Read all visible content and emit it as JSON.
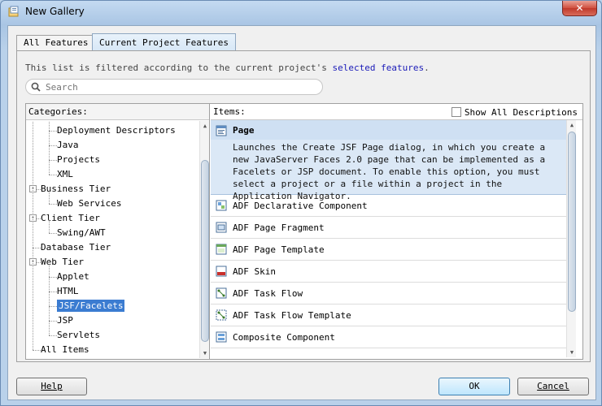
{
  "window": {
    "title": "New Gallery",
    "close_label": "✕"
  },
  "tabs": [
    {
      "label": "All Features",
      "active": false
    },
    {
      "label": "Current Project Features",
      "active": true
    }
  ],
  "filter": {
    "text": "This list is filtered according to the current project's ",
    "link": "selected features",
    "suffix": "."
  },
  "search": {
    "placeholder": "Search"
  },
  "categories": {
    "header": "Categories:",
    "items": [
      {
        "label": "Deployment Descriptors",
        "level": 2
      },
      {
        "label": "Java",
        "level": 2
      },
      {
        "label": "Projects",
        "level": 2
      },
      {
        "label": "XML",
        "level": 2
      },
      {
        "label": "Business Tier",
        "level": 1,
        "expander": "-"
      },
      {
        "label": "Web Services",
        "level": 2
      },
      {
        "label": "Client Tier",
        "level": 1,
        "expander": "-"
      },
      {
        "label": "Swing/AWT",
        "level": 2
      },
      {
        "label": "Database Tier",
        "level": 1
      },
      {
        "label": "Web Tier",
        "level": 1,
        "expander": "-"
      },
      {
        "label": "Applet",
        "level": 2
      },
      {
        "label": "HTML",
        "level": 2
      },
      {
        "label": "JSF/Facelets",
        "level": 2,
        "selected": true
      },
      {
        "label": "JSP",
        "level": 2
      },
      {
        "label": "Servlets",
        "level": 2
      },
      {
        "label": "All Items",
        "level": 1
      }
    ]
  },
  "items_pane": {
    "header": "Items:",
    "show_all_label": "Show All Descriptions",
    "show_all_checked": false,
    "selected": {
      "name": "Page",
      "description": "Launches the Create JSF Page dialog, in which you create a new JavaServer Faces 2.0 page that can be implemented as a Facelets or JSP document. To enable this option, you must select a project or a file within a project in the Application Navigator."
    },
    "items": [
      {
        "name": "ADF Declarative Component",
        "icon": "component-icon"
      },
      {
        "name": "ADF Page Fragment",
        "icon": "page-fragment-icon"
      },
      {
        "name": "ADF Page Template",
        "icon": "page-template-icon"
      },
      {
        "name": "ADF Skin",
        "icon": "css-skin-icon"
      },
      {
        "name": "ADF Task Flow",
        "icon": "task-flow-icon"
      },
      {
        "name": "ADF Task Flow Template",
        "icon": "task-flow-template-icon"
      },
      {
        "name": "Composite Component",
        "icon": "composite-icon"
      }
    ]
  },
  "buttons": {
    "help": "Help",
    "ok": "OK",
    "cancel": "Cancel"
  }
}
